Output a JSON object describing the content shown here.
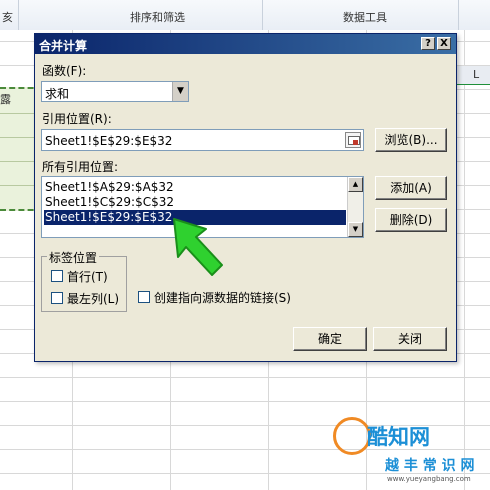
{
  "ribbon": {
    "group_left_fragment": "亥",
    "group_sort_filter": "排序和筛选",
    "group_data_tools": "数据工具"
  },
  "sheet": {
    "left_fragment": "露",
    "column_header": "L"
  },
  "dialog": {
    "title": "合并计算",
    "help_button": "?",
    "close_button": "X",
    "function_label": "函数(F):",
    "function_value": "求和",
    "reference_label": "引用位置(R):",
    "reference_value": "Sheet1!$E$29:$E$32",
    "browse_button": "浏览(B)...",
    "all_references_label": "所有引用位置:",
    "references": [
      "Sheet1!$A$29:$A$32",
      "Sheet1!$C$29:$C$32",
      "Sheet1!$E$29:$E$32"
    ],
    "selected_reference_index": 2,
    "add_button": "添加(A)",
    "delete_button": "删除(D)",
    "labels_group": "标签位置",
    "first_row_label": "首行(T)",
    "first_row_checked": false,
    "left_column_label": "最左列(L)",
    "left_column_checked": false,
    "create_links_label": "创建指向源数据的链接(S)",
    "create_links_checked": false,
    "ok_button": "确定",
    "close_text_button": "关闭"
  },
  "watermark": {
    "brand": "酷知网",
    "sub": "越 丰 常 识 网",
    "url": "www.yueyangbang.com"
  },
  "colors": {
    "title_bar": "#0a246a",
    "selection": "#0a246a",
    "dialog_bg": "#ece9d8",
    "arrow": "#2fd12f",
    "range_fill": "#eaf2dc"
  }
}
